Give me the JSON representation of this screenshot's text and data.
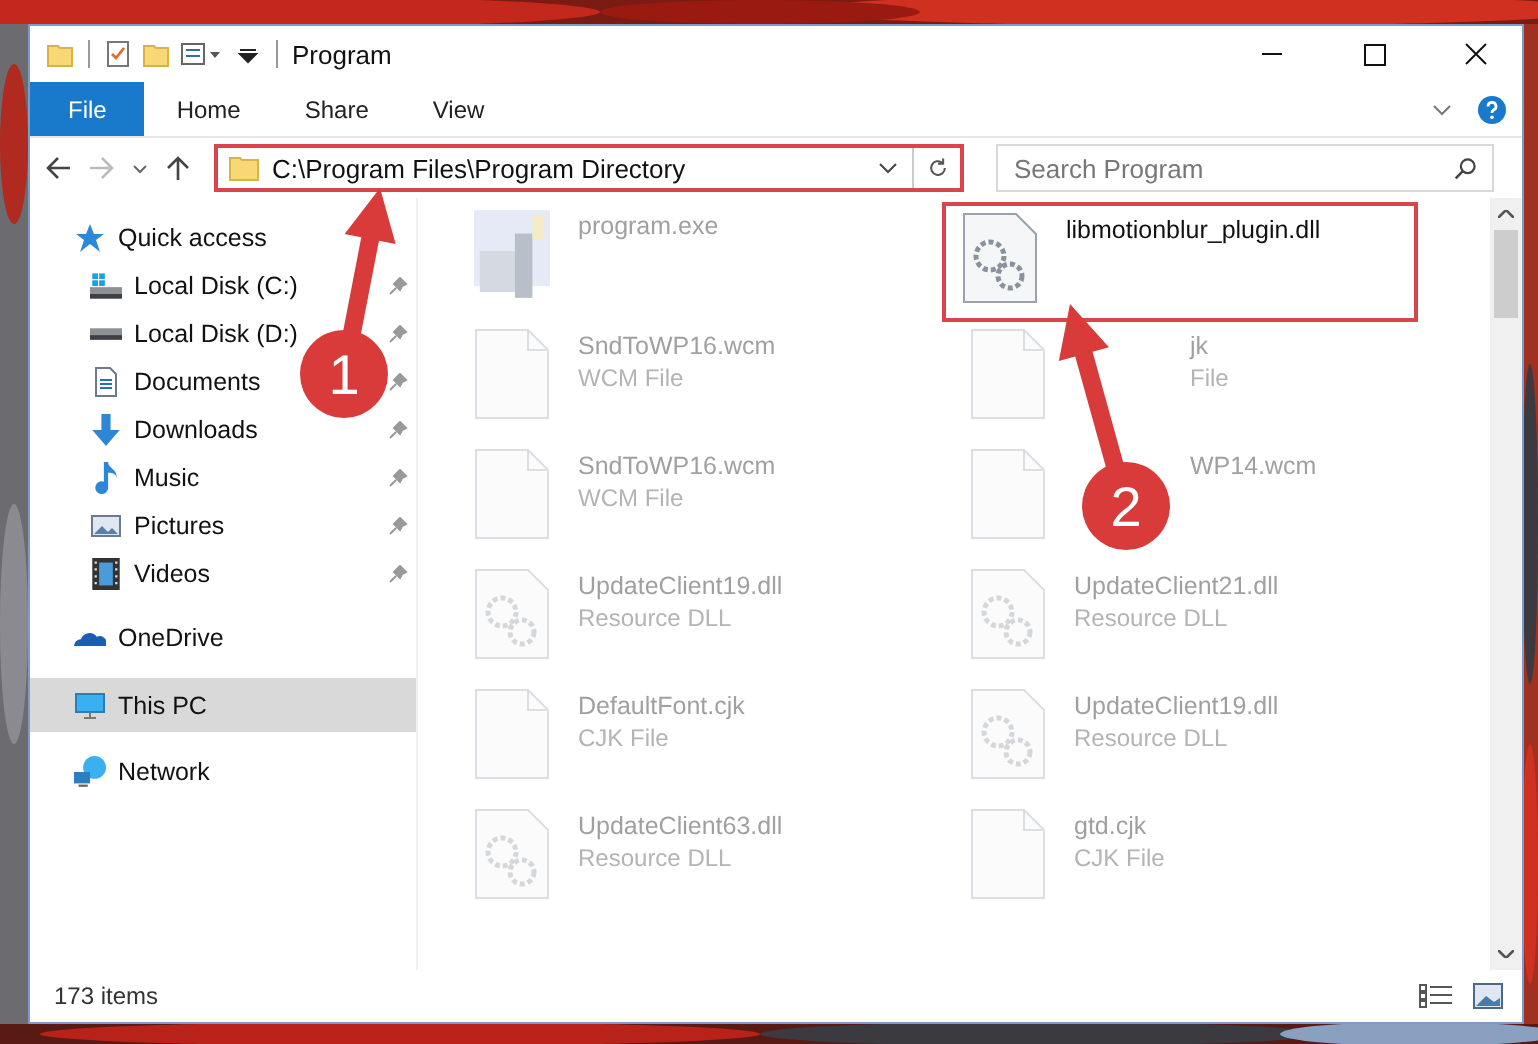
{
  "window": {
    "title": "Program"
  },
  "ribbon": {
    "tabs": [
      {
        "label": "File",
        "selected": true
      },
      {
        "label": "Home",
        "selected": false
      },
      {
        "label": "Share",
        "selected": false
      },
      {
        "label": "View",
        "selected": false
      }
    ]
  },
  "address": {
    "path": "C:\\Program Files\\Program Directory",
    "highlighted": true
  },
  "search": {
    "placeholder": "Search Program"
  },
  "sidebar": {
    "items": [
      {
        "label": "Quick access",
        "kind": "star",
        "pinned": false,
        "selected": false,
        "children": [
          {
            "label": "Local Disk (C:)",
            "kind": "disk-c",
            "pinned": true,
            "selected": false
          },
          {
            "label": "Local Disk (D:)",
            "kind": "disk",
            "pinned": true,
            "selected": false
          },
          {
            "label": "Documents",
            "kind": "document",
            "pinned": true,
            "selected": false
          },
          {
            "label": "Downloads",
            "kind": "download",
            "pinned": true,
            "selected": false
          },
          {
            "label": "Music",
            "kind": "music",
            "pinned": true,
            "selected": false
          },
          {
            "label": "Pictures",
            "kind": "pictures",
            "pinned": true,
            "selected": false
          },
          {
            "label": "Videos",
            "kind": "video",
            "pinned": true,
            "selected": false
          }
        ]
      },
      {
        "label": "OneDrive",
        "kind": "cloud",
        "pinned": false,
        "selected": false
      },
      {
        "label": "This PC",
        "kind": "pc",
        "pinned": false,
        "selected": true
      },
      {
        "label": "Network",
        "kind": "network",
        "pinned": false,
        "selected": false
      }
    ]
  },
  "files": [
    {
      "name": "program.exe",
      "kind": "exe",
      "highlighted": false,
      "faded": true
    },
    {
      "name": "libmotionblur_plugin.dll",
      "kind": "gear",
      "highlighted": true,
      "faded": false
    },
    {
      "name": "SndToWP16.wcm",
      "type": "WCM File",
      "kind": "page",
      "highlighted": false,
      "faded": true
    },
    {
      "name": "jk",
      "type": "File",
      "kind": "page",
      "highlighted": false,
      "faded": true,
      "covered": true
    },
    {
      "name": "SndToWP16.wcm",
      "type": "WCM File",
      "kind": "page",
      "highlighted": false,
      "faded": true
    },
    {
      "name": "WP14.wcm",
      "kind": "page",
      "highlighted": false,
      "faded": true,
      "covered": true
    },
    {
      "name": "UpdateClient19.dll",
      "type": "Resource DLL",
      "kind": "gear",
      "highlighted": false,
      "faded": true
    },
    {
      "name": "UpdateClient21.dll",
      "type": "Resource DLL",
      "kind": "gear",
      "highlighted": false,
      "faded": true
    },
    {
      "name": "DefaultFont.cjk",
      "type": "CJK File",
      "kind": "page",
      "highlighted": false,
      "faded": true
    },
    {
      "name": "UpdateClient19.dll",
      "type": "Resource DLL",
      "kind": "gear",
      "highlighted": false,
      "faded": true
    },
    {
      "name": "UpdateClient63.dll",
      "type": "Resource DLL",
      "kind": "gear",
      "highlighted": false,
      "faded": true
    },
    {
      "name": "gtd.cjk",
      "type": "CJK File",
      "kind": "page",
      "highlighted": false,
      "faded": true
    }
  ],
  "status_bar": {
    "count": "173 items"
  },
  "annotations": [
    {
      "number": "1"
    },
    {
      "number": "2"
    }
  ]
}
